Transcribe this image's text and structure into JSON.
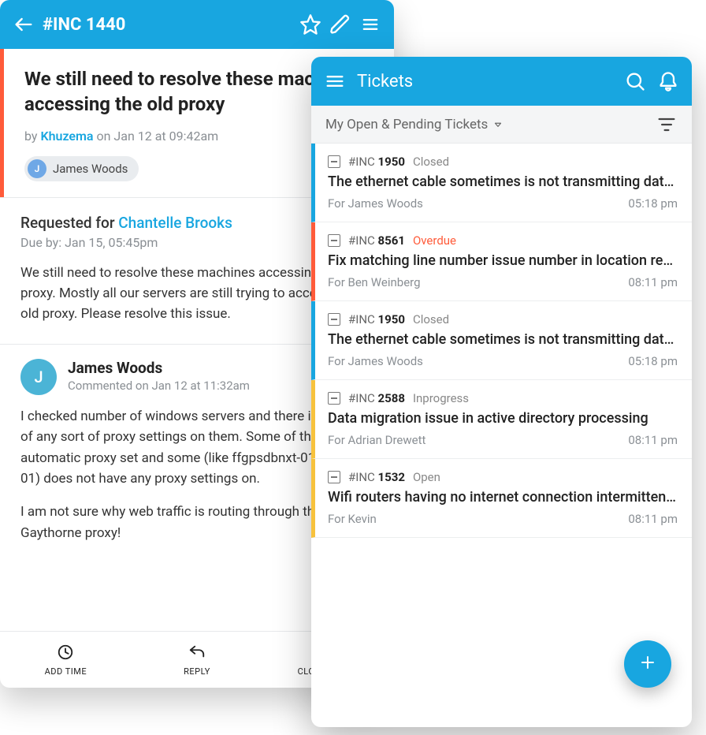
{
  "detail": {
    "header": {
      "ticket_id": "#INC 1440"
    },
    "subject": "We still need to resolve these machines accessing the old proxy",
    "byline": {
      "prefix": "by ",
      "author": "Khuzema",
      "date": " on Jan 12 at 09:42am"
    },
    "assignee": {
      "initial": "J",
      "name": "James Woods"
    },
    "requested_for": {
      "label": "Requested for  ",
      "name": "Chantelle Brooks"
    },
    "due_by": "Due by: Jan 15, 05:45pm",
    "description": "We still need to resolve these machines accessing the old proxy. Mostly all our servers are still trying to access our old proxy. Please resolve this issue.",
    "comment": {
      "initial": "J",
      "author": "James Woods",
      "date": "Commented on Jan 12 at 11:32am",
      "p1": "I checked number of windows servers and there is no sign of any sort of proxy settings on them. Some of them have automatic proxy set and some (like ffgpsdbnxt-01, flscorp-01) does not have any proxy settings on.",
      "p2": "I am not sure why web traffic is routing through the Gaythorne proxy!"
    },
    "actions": {
      "add_time": "ADD TIME",
      "reply": "REPLY",
      "close": "CLOSE TICKET"
    }
  },
  "list": {
    "header": {
      "title": "Tickets"
    },
    "filter": {
      "label": "My Open & Pending Tickets"
    },
    "items": [
      {
        "border": "blue",
        "id_prefix": "#INC ",
        "id_num": "1950",
        "status": "Closed",
        "status_class": "",
        "subject": "The ethernet cable sometimes is not transmitting data properly",
        "for": "For James Woods",
        "time": "05:18 pm"
      },
      {
        "border": "orange",
        "id_prefix": "#INC ",
        "id_num": "8561",
        "status": "Overdue",
        "status_class": "overdue",
        "subject": "Fix matching line number issue number in location report",
        "for": "For Ben Weinberg",
        "time": "08:11 pm"
      },
      {
        "border": "blue",
        "id_prefix": "#INC ",
        "id_num": "1950",
        "status": "Closed",
        "status_class": "",
        "subject": "The ethernet cable sometimes is not transmitting data properly",
        "for": "For James Woods",
        "time": "05:18 pm"
      },
      {
        "border": "yellow",
        "id_prefix": "#INC ",
        "id_num": "2588",
        "status": "Inprogress",
        "status_class": "",
        "subject": "Data migration issue in active directory processing",
        "for": "For Adrian Drewett",
        "time": "08:11 pm"
      },
      {
        "border": "yellow",
        "id_prefix": "#INC ",
        "id_num": "1532",
        "status": "Open",
        "status_class": "",
        "subject": "Wifi routers having no internet connection intermittently",
        "for": "For Kevin",
        "time": "08:11 pm"
      }
    ]
  }
}
